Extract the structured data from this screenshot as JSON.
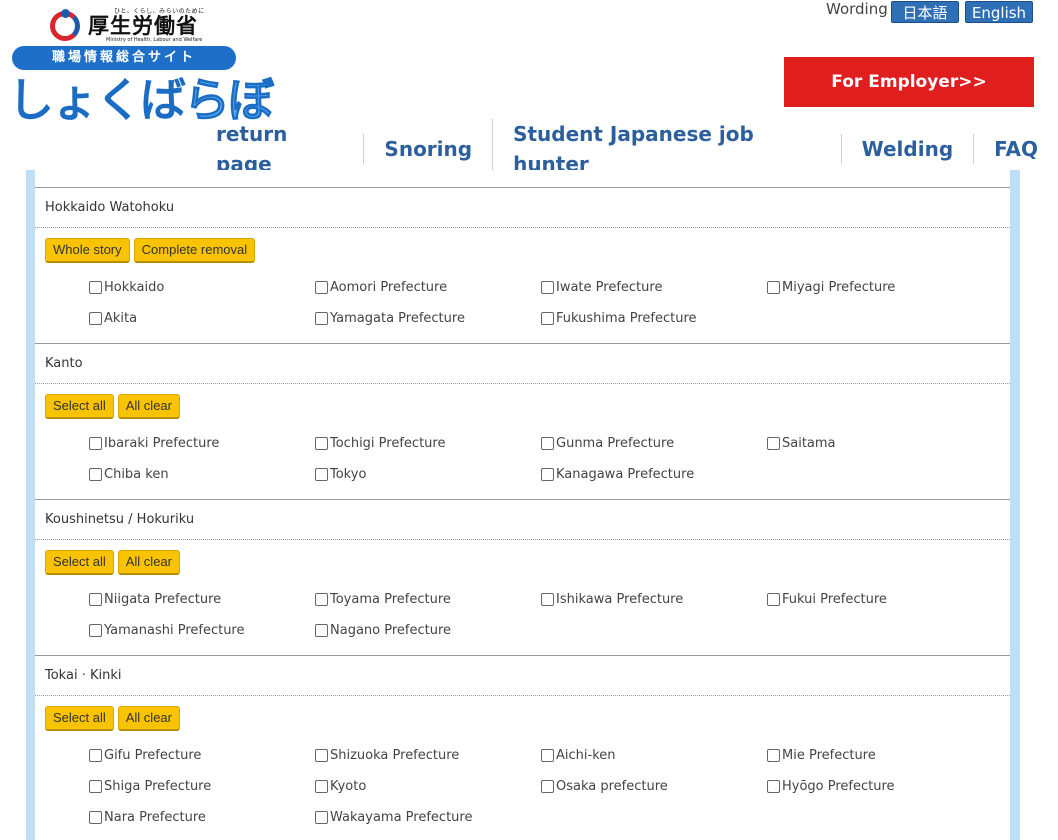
{
  "header": {
    "ministry_small": "ひと、くらし、みらいのために",
    "ministry_name": "厚生労働省",
    "ministry_en": "Ministry of Health, Labour and Welfare",
    "site_banner": "職場情報総合サイト",
    "brand_part1": "しょくば",
    "brand_part2": "らぼ",
    "wording_label": "Wording",
    "lang_japanese": "日本語",
    "lang_english": "English",
    "employer_button": "For Employer>>"
  },
  "nav": [
    "return page",
    "Snoring",
    "Student Japanese job hunter",
    "Welding",
    "FAQ"
  ],
  "regions": [
    {
      "title": "Hokkaido Watohoku",
      "buttons": [
        "Whole story",
        "Complete removal"
      ],
      "items": [
        "Hokkaido",
        "Aomori Prefecture",
        "Iwate Prefecture",
        "Miyagi Prefecture",
        "Akita",
        "Yamagata Prefecture",
        "Fukushima Prefecture"
      ]
    },
    {
      "title": "Kanto",
      "buttons": [
        "Select all",
        "All clear"
      ],
      "items": [
        "Ibaraki Prefecture",
        "Tochigi Prefecture",
        "Gunma Prefecture",
        "Saitama",
        "Chiba ken",
        "Tokyo",
        "Kanagawa Prefecture"
      ]
    },
    {
      "title": "Koushinetsu / Hokuriku",
      "buttons": [
        "Select all",
        "All clear"
      ],
      "items": [
        "Niigata Prefecture",
        "Toyama Prefecture",
        "Ishikawa Prefecture",
        "Fukui Prefecture",
        "Yamanashi Prefecture",
        "Nagano Prefecture"
      ]
    },
    {
      "title": "Tokai · Kinki",
      "buttons": [
        "Select all",
        "All clear"
      ],
      "items": [
        "Gifu Prefecture",
        "Shizuoka Prefecture",
        "Aichi-ken",
        "Mie Prefecture",
        "Shiga Prefecture",
        "Kyoto",
        "Osaka prefecture",
        "Hyōgo Prefecture",
        "Nara Prefecture",
        "Wakayama Prefecture"
      ]
    }
  ]
}
